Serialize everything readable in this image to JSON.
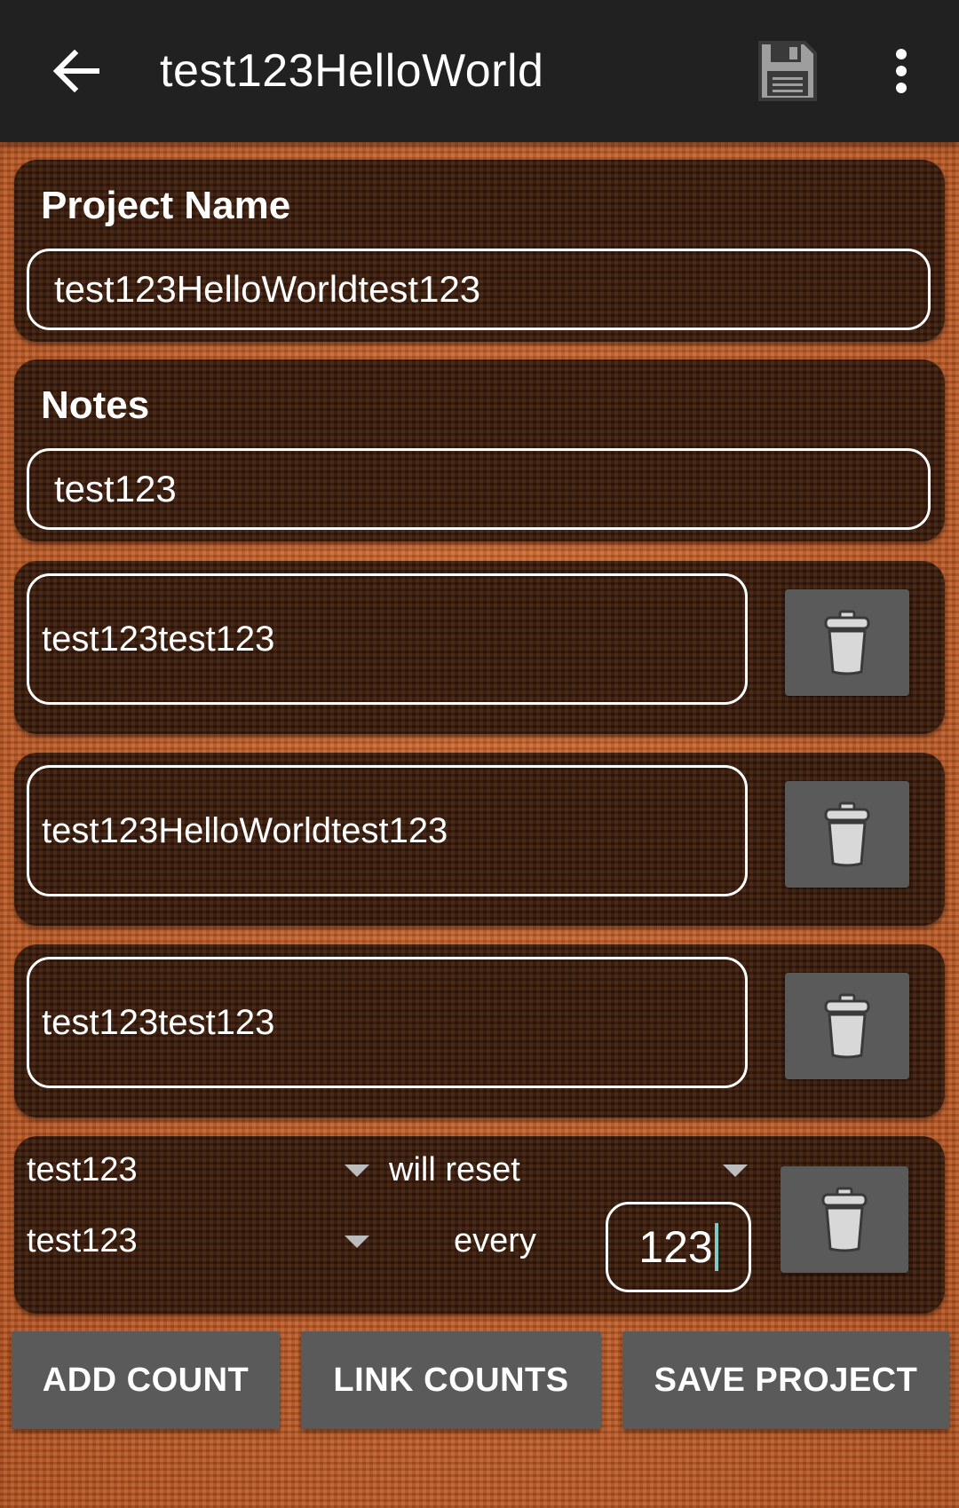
{
  "app_bar": {
    "title": "test123HelloWorld",
    "back_icon": "arrow-left-icon",
    "save_icon": "floppy-disk-icon",
    "more_icon": "more-vertical-icon",
    "background_color": "#212121"
  },
  "project_name": {
    "label": "Project Name",
    "value": "test123HelloWorldtest123"
  },
  "notes": {
    "label": "Notes",
    "value": "test123"
  },
  "counts": [
    {
      "value": "test123test123"
    },
    {
      "value": "test123HelloWorldtest123"
    },
    {
      "value": "test123test123"
    }
  ],
  "link": {
    "first_count": "test123",
    "reset_option": "will reset",
    "second_count": "test123",
    "every_label": "every",
    "interval_value": "123"
  },
  "buttons": {
    "add_count": "ADD COUNT",
    "link_counts": "LINK COUNTS",
    "save_project": "SAVE PROJECT"
  },
  "colors": {
    "background": "#c4602a",
    "card": "#3e1d0b",
    "button": "#5a5a5a",
    "cursor": "#80cbc4"
  }
}
